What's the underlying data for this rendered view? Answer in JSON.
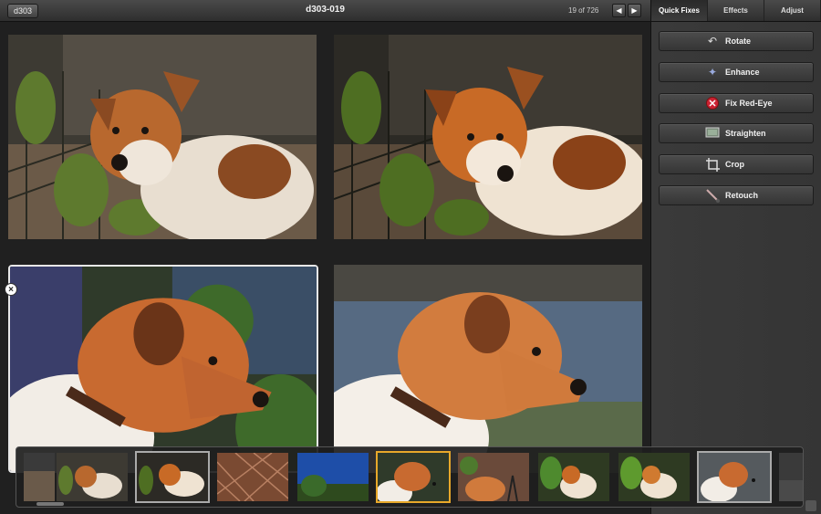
{
  "header": {
    "back_label": "d303",
    "title": "d303-019",
    "counter": "19 of 726",
    "prev_icon": "arrow-left-icon",
    "next_icon": "arrow-right-icon"
  },
  "panel": {
    "tabs": [
      {
        "label": "Quick Fixes",
        "active": true
      },
      {
        "label": "Effects",
        "active": false
      },
      {
        "label": "Adjust",
        "active": false
      }
    ],
    "tools": [
      {
        "label": "Rotate",
        "icon": "rotate-icon"
      },
      {
        "label": "Enhance",
        "icon": "enhance-wand-icon"
      },
      {
        "label": "Fix Red-Eye",
        "icon": "red-eye-icon"
      },
      {
        "label": "Straighten",
        "icon": "straighten-icon"
      },
      {
        "label": "Crop",
        "icon": "crop-icon"
      },
      {
        "label": "Retouch",
        "icon": "retouch-brush-icon"
      }
    ]
  },
  "photos": [
    {
      "subject": "dog-by-fence"
    },
    {
      "subject": "dog-by-fence-enhanced"
    },
    {
      "subject": "dog-profile",
      "selected": true
    },
    {
      "subject": "dog-profile-bright"
    }
  ],
  "filmstrip": {
    "current_index": 5,
    "selected_index": 2
  },
  "colors": {
    "accent_current": "#e8a82a",
    "selection_border": "#e8e8e8",
    "red_eye": "#cc2233"
  }
}
